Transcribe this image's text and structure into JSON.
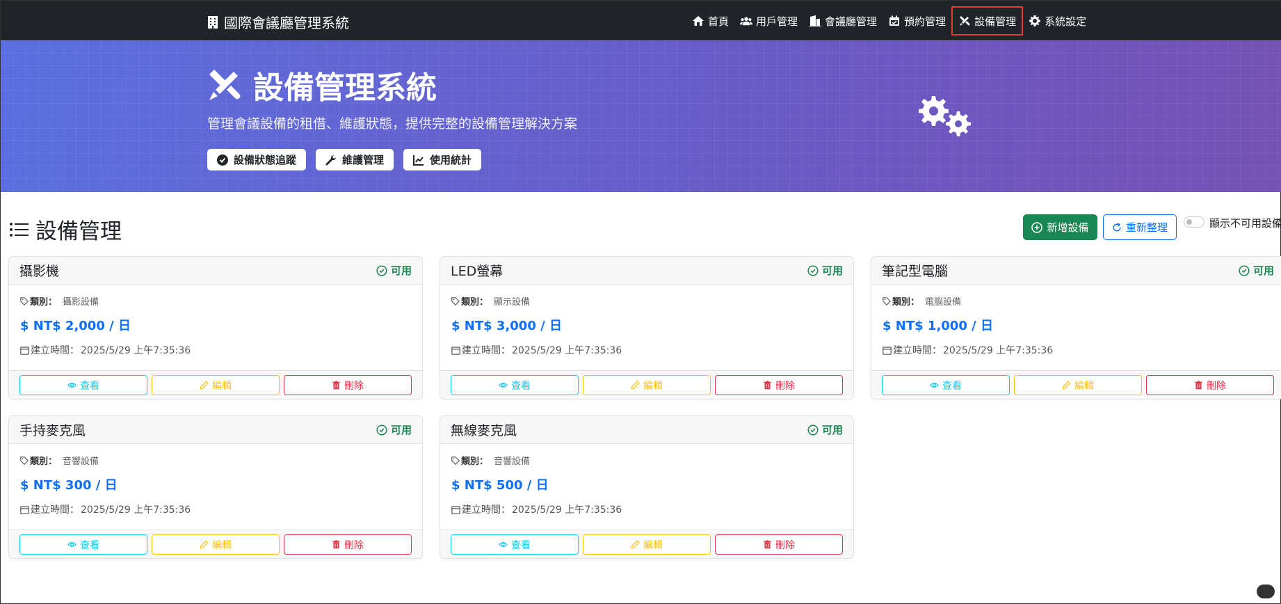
{
  "navbar": {
    "brand": "國際會議廳管理系統",
    "items": [
      {
        "label": "首頁",
        "icon": "home-icon"
      },
      {
        "label": "用戶管理",
        "icon": "users-icon"
      },
      {
        "label": "會議廳管理",
        "icon": "building-icon"
      },
      {
        "label": "預約管理",
        "icon": "calendar-icon"
      },
      {
        "label": "設備管理",
        "icon": "tools-icon",
        "active": true
      },
      {
        "label": "系統設定",
        "icon": "gear-icon"
      }
    ]
  },
  "hero": {
    "title": "設備管理系統",
    "subtitle": "管理會議設備的租借、維護狀態，提供完整的設備管理解決方案",
    "buttons": [
      {
        "label": "設備狀態追蹤",
        "icon": "check-circle-icon"
      },
      {
        "label": "維護管理",
        "icon": "wrench-icon"
      },
      {
        "label": "使用統計",
        "icon": "chart-line-icon"
      }
    ]
  },
  "section": {
    "title": "設備管理",
    "add_label": "新增設備",
    "refresh_label": "重新整理",
    "toggle_label": "顯示不可用設備"
  },
  "labels": {
    "category": "類別：",
    "created": "建立時間：",
    "view": "查看",
    "edit": "編輯",
    "delete": "刪除"
  },
  "equipment": [
    {
      "name": "攝影機",
      "status": "可用",
      "category": "攝影設備",
      "price": "$ NT$ 2,000 / 日",
      "created": "2025/5/29 上午7:35:36"
    },
    {
      "name": "LED螢幕",
      "status": "可用",
      "category": "顯示設備",
      "price": "$ NT$ 3,000 / 日",
      "created": "2025/5/29 上午7:35:36"
    },
    {
      "name": "筆記型電腦",
      "status": "可用",
      "category": "電腦設備",
      "price": "$ NT$ 1,000 / 日",
      "created": "2025/5/29 上午7:35:36"
    },
    {
      "name": "手持麥克風",
      "status": "可用",
      "category": "音響設備",
      "price": "$ NT$ 300 / 日",
      "created": "2025/5/29 上午7:35:36"
    },
    {
      "name": "無線麥克風",
      "status": "可用",
      "category": "音響設備",
      "price": "$ NT$ 500 / 日",
      "created": "2025/5/29 上午7:35:36"
    }
  ],
  "colors": {
    "navbar": "#212529",
    "hero_start": "#5b6fe0",
    "hero_end": "#7552b5",
    "success": "#198754",
    "primary": "#0d6efd",
    "info": "#0dcaf0",
    "warning": "#ffc107",
    "danger": "#dc3545"
  }
}
